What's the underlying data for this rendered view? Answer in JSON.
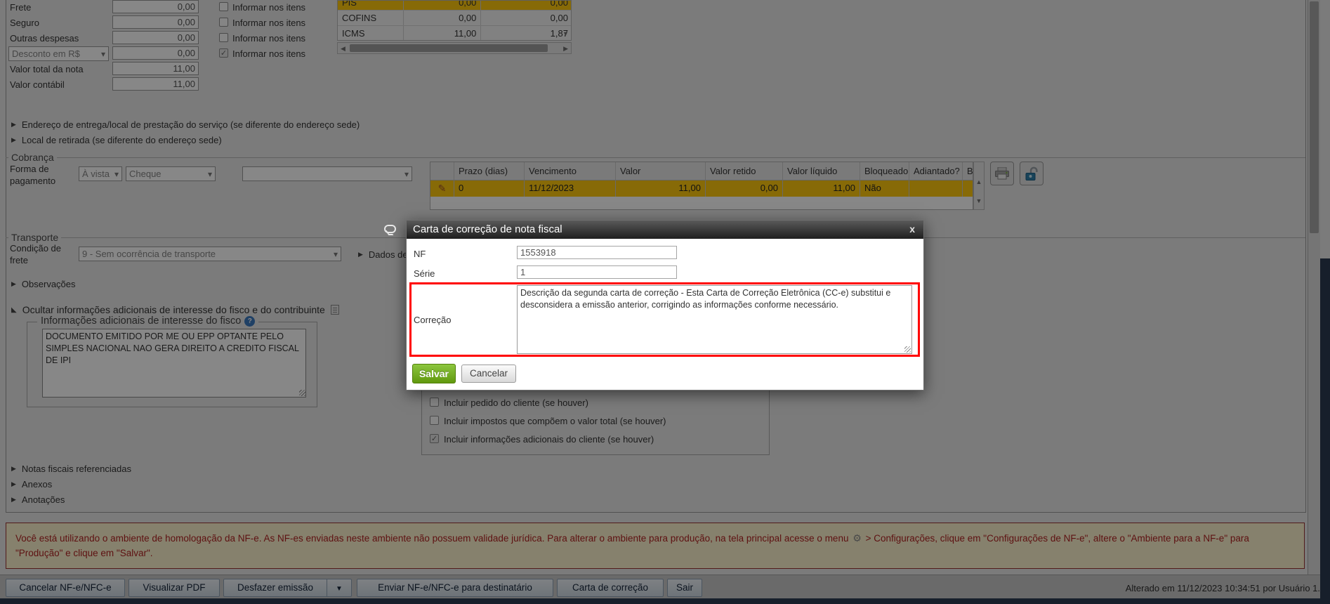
{
  "icons": {
    "collapse_arrow": "▶",
    "expand_arrow": "◣",
    "select_chevron": "▾",
    "scroll_up": "▲",
    "scroll_down": "▼",
    "scroll_left": "◀",
    "scroll_right": "▶",
    "check": "✓",
    "pencil": "✎",
    "gear": "⚙",
    "help": "?",
    "close": "x",
    "dropdown": "▼"
  },
  "left_form": {
    "inform_label": "Informar nos itens",
    "rows": [
      {
        "label": "Frete",
        "value": "0,00"
      },
      {
        "label": "Seguro",
        "value": "0,00"
      },
      {
        "label": "Outras despesas",
        "value": "0,00"
      },
      {
        "label": "Desconto em R$",
        "value": "0,00"
      },
      {
        "label": "Valor total da nota",
        "value": "11,00"
      },
      {
        "label": "Valor contábil",
        "value": "11,00"
      }
    ]
  },
  "tax_table": {
    "rows": [
      {
        "name": "PIS",
        "v1": "0,00",
        "v2": "0,00"
      },
      {
        "name": "COFINS",
        "v1": "0,00",
        "v2": "0,00"
      },
      {
        "name": "ICMS",
        "v1": "11,00",
        "v2": "1,87"
      }
    ]
  },
  "sections": {
    "endereco": "Endereço de entrega/local de prestação do serviço (se diferente do endereço sede)",
    "retirada": "Local de retirada (se diferente do endereço sede)",
    "dados_de": "Dados de",
    "observacoes": "Observações",
    "ocultar": "Ocultar informações adicionais de interesse do fisco e do contribuinte",
    "notas": "Notas fiscais referenciadas",
    "anexos": "Anexos",
    "anotacoes": "Anotações"
  },
  "cobranca": {
    "legend": "Cobrança",
    "forma_label": "Forma de pagamento",
    "select1": "À vista",
    "select2": "Cheque",
    "select3": "",
    "table": {
      "headers": [
        "",
        "Prazo (dias)",
        "Vencimento",
        "Valor",
        "Valor retido",
        "Valor líquido",
        "Bloqueado",
        "Adiantado?",
        "Bo"
      ],
      "row": {
        "prazo": "0",
        "vencimento": "11/12/2023",
        "valor": "11,00",
        "valor_retido": "0,00",
        "valor_liquido": "11,00",
        "bloqueado": "Não",
        "adiantado": ""
      }
    }
  },
  "transporte": {
    "legend": "Transporte",
    "condicao_label": "Condição de frete",
    "condicao_value": "9 - Sem ocorrência de transporte"
  },
  "fisco": {
    "legend": "Informações adicionais de interesse do fisco",
    "text": "DOCUMENTO EMITIDO POR ME OU EPP OPTANTE PELO SIMPLES NACIONAL NAO GERA DIREITO A CREDITO FISCAL DE IPI"
  },
  "contribuinte": {
    "checkboxes": [
      {
        "label": "Incluir pedido do cliente (se houver)",
        "checked": false
      },
      {
        "label": "Incluir impostos que compõem o valor total (se houver)",
        "checked": false
      },
      {
        "label": "Incluir informações adicionais do cliente (se houver)",
        "checked": true
      }
    ]
  },
  "modal": {
    "title": "Carta de correção de nota fiscal",
    "nf_label": "NF",
    "nf_value": "1553918",
    "serie_label": "Série",
    "serie_value": "1",
    "correcao_label": "Correção",
    "correcao_value": "Descrição da segunda carta de correção - Esta Carta de Correção Eletrônica (CC-e) substitui e desconsidera a emissão anterior, corrigindo as informações conforme necessário.",
    "save_label": "Salvar",
    "cancel_label": "Cancelar"
  },
  "warning": {
    "part1": "Você está utilizando o ambiente de homologação da NF-e. As NF-es enviadas neste ambiente não possuem validade jurídica. Para alterar o ambiente para produção, na tela principal acesse o menu",
    "part2": "> Configurações, clique em \"Configurações de NF-e\", altere o \"Ambiente para a NF-e\" para \"Produção\" e clique em \"Salvar\"."
  },
  "toolbar": {
    "buttons": [
      "Cancelar NF-e/NFC-e",
      "Visualizar PDF",
      "Desfazer emissão",
      "Enviar NF-e/NFC-e para destinatário",
      "Carta de correção",
      "Sair"
    ],
    "status": "Alterado em 11/12/2023 10:34:51 por Usuário 1."
  },
  "colors": {
    "selected_row": "#ffc90e",
    "save_green": "#61990e",
    "alert_red": "#b22222",
    "highlight_border": "#ff0000",
    "lock_blue": "#2e7fa8"
  }
}
